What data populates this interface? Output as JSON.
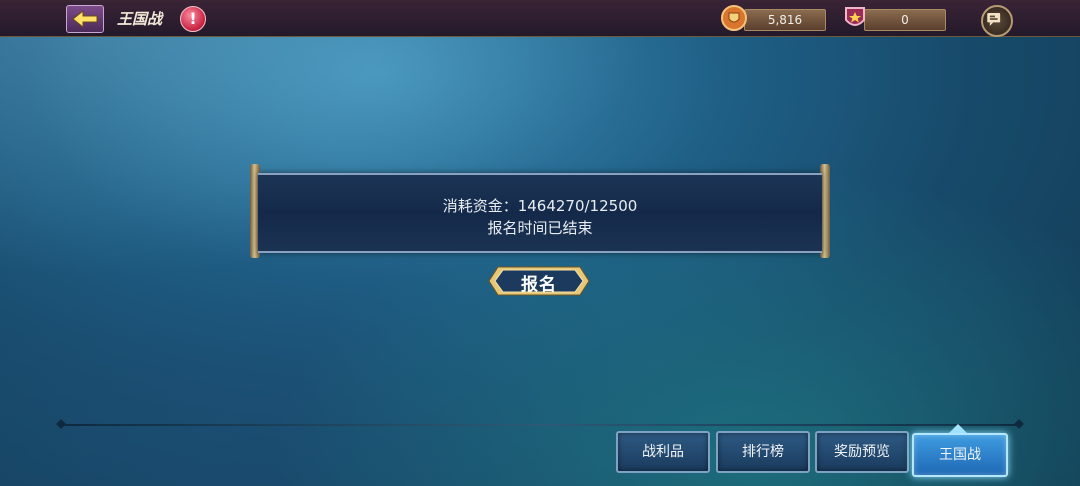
{
  "header": {
    "title": "王国战",
    "alert_mark": "!",
    "resource_1": "5,816",
    "resource_2": "0"
  },
  "panel": {
    "cost_line": "消耗资金：1464270/12500",
    "status_line": "报名时间已结束"
  },
  "signup_button": "报名",
  "tabs": [
    {
      "label": "战利品"
    },
    {
      "label": "排行榜"
    },
    {
      "label": "奖励预览"
    },
    {
      "label": "王国战",
      "active": true
    }
  ],
  "icons": {
    "back": "back-arrow-icon",
    "alert": "exclamation-icon",
    "resource_1": "shield-coin-icon",
    "resource_2": "star-badge-icon",
    "chat": "chat-icon"
  }
}
